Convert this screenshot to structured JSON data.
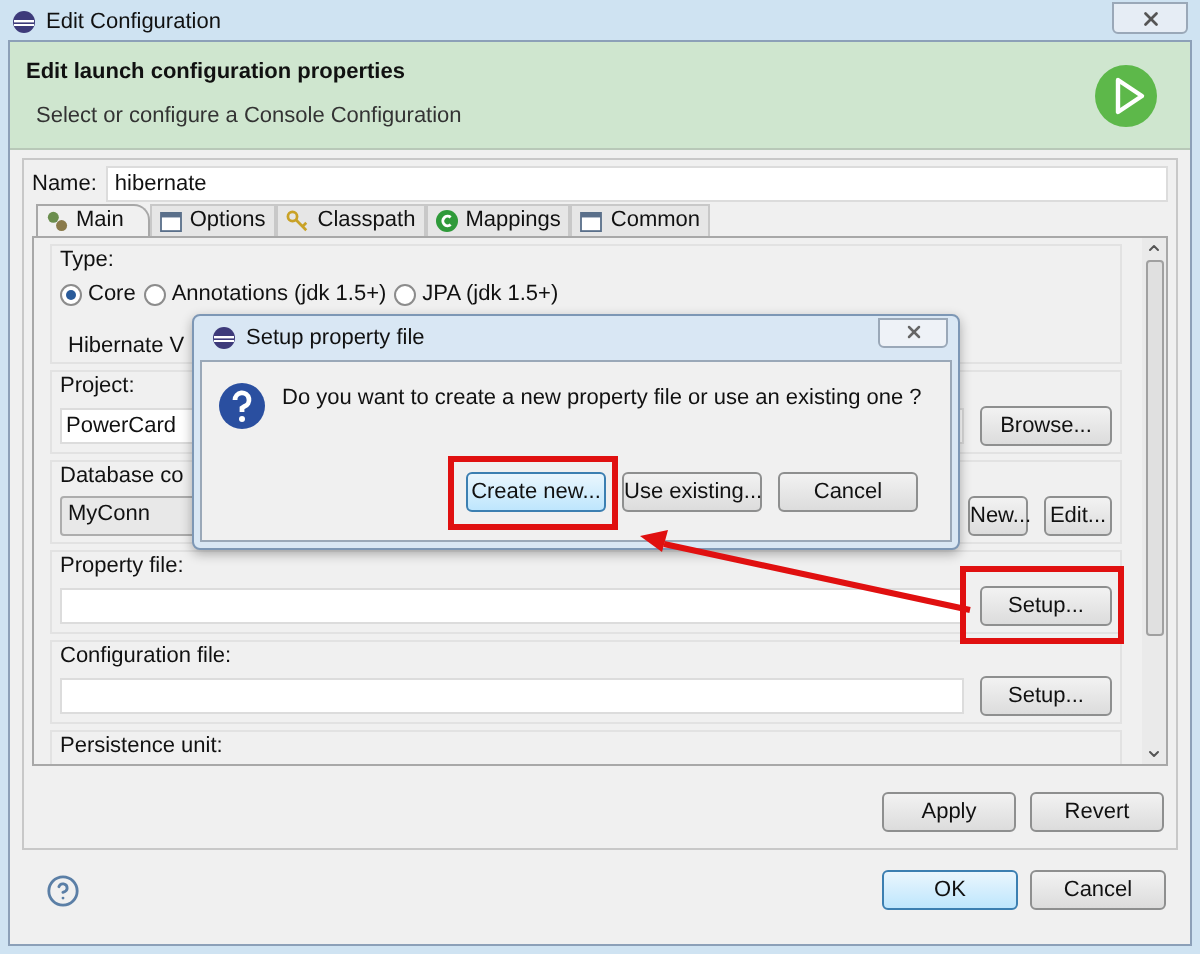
{
  "window": {
    "title": "Edit Configuration"
  },
  "header": {
    "title": "Edit launch configuration properties",
    "subtitle": "Select or configure a Console Configuration"
  },
  "name_field": {
    "label": "Name:",
    "value": "hibernate"
  },
  "tabs": [
    {
      "label": "Main",
      "selected": true
    },
    {
      "label": "Options",
      "selected": false
    },
    {
      "label": "Classpath",
      "selected": false
    },
    {
      "label": "Mappings",
      "selected": false
    },
    {
      "label": "Common",
      "selected": false
    }
  ],
  "main_tab": {
    "type_label": "Type:",
    "type_options": [
      {
        "label": "Core",
        "selected": true
      },
      {
        "label": "Annotations (jdk 1.5+)",
        "selected": false
      },
      {
        "label": "JPA (jdk 1.5+)",
        "selected": false
      }
    ],
    "hibernate_version_label": "Hibernate V",
    "project": {
      "label": "Project:",
      "value": "PowerCard",
      "button": "Browse..."
    },
    "database_connection": {
      "label": "Database co",
      "value": "MyConn",
      "buttons": [
        "New...",
        "Edit..."
      ]
    },
    "property_file": {
      "label": "Property file:",
      "button": "Setup...",
      "highlighted": true
    },
    "configuration_file": {
      "label": "Configuration file:",
      "button": "Setup...",
      "highlighted": false
    },
    "persistence_unit": {
      "label": "Persistence unit:"
    }
  },
  "panel_buttons": [
    "Apply",
    "Revert"
  ],
  "footer_buttons": [
    {
      "label": "OK",
      "default": true
    },
    {
      "label": "Cancel",
      "default": false
    }
  ],
  "popup": {
    "title": "Setup property file",
    "message": "Do you want to create a new property file or use an existing one ?",
    "buttons": [
      {
        "label": "Create new...",
        "default": true,
        "highlighted": true
      },
      {
        "label": "Use existing...",
        "default": false,
        "highlighted": false
      },
      {
        "label": "Cancel",
        "default": false,
        "highlighted": false
      }
    ]
  }
}
